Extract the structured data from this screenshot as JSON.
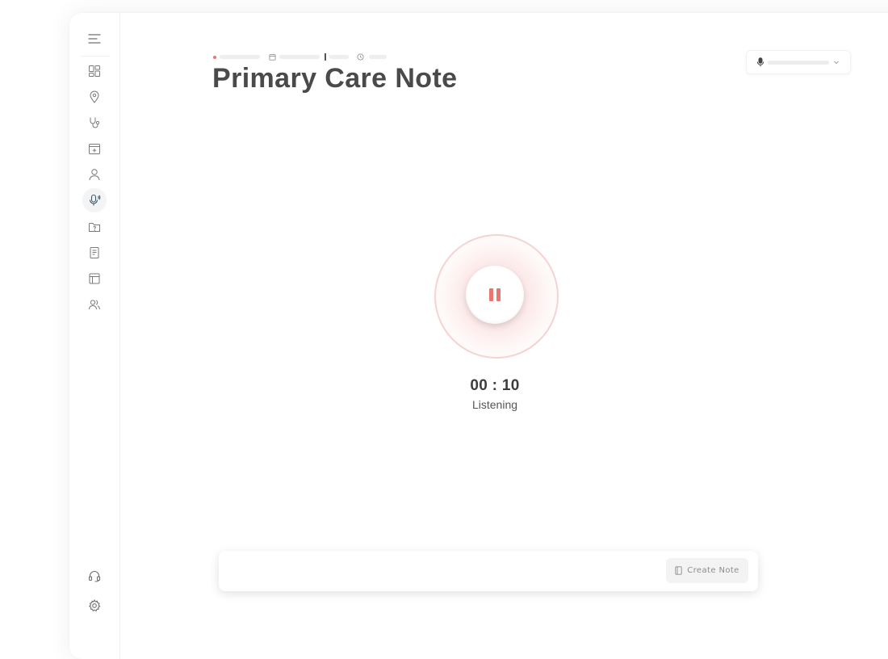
{
  "header": {
    "title": "Primary Care Note"
  },
  "recorder": {
    "timer": "00 : 10",
    "status": "Listening"
  },
  "footer": {
    "create_note_label": "Create Note"
  },
  "colors": {
    "accent": "#e8776f",
    "text_primary": "#4a4a4a",
    "icon": "#7a7a7a"
  },
  "sidebar": {
    "items": [
      {
        "icon": "menu-icon"
      },
      {
        "icon": "dashboard-icon"
      },
      {
        "icon": "location-pin-icon"
      },
      {
        "icon": "stethoscope-icon"
      },
      {
        "icon": "calendar-add-icon"
      },
      {
        "icon": "user-icon"
      },
      {
        "icon": "microphone-icon",
        "active": true
      },
      {
        "icon": "folder-question-icon"
      },
      {
        "icon": "document-icon"
      },
      {
        "icon": "layout-icon"
      },
      {
        "icon": "users-icon"
      },
      {
        "icon": "headset-icon"
      },
      {
        "icon": "settings-icon"
      }
    ]
  }
}
